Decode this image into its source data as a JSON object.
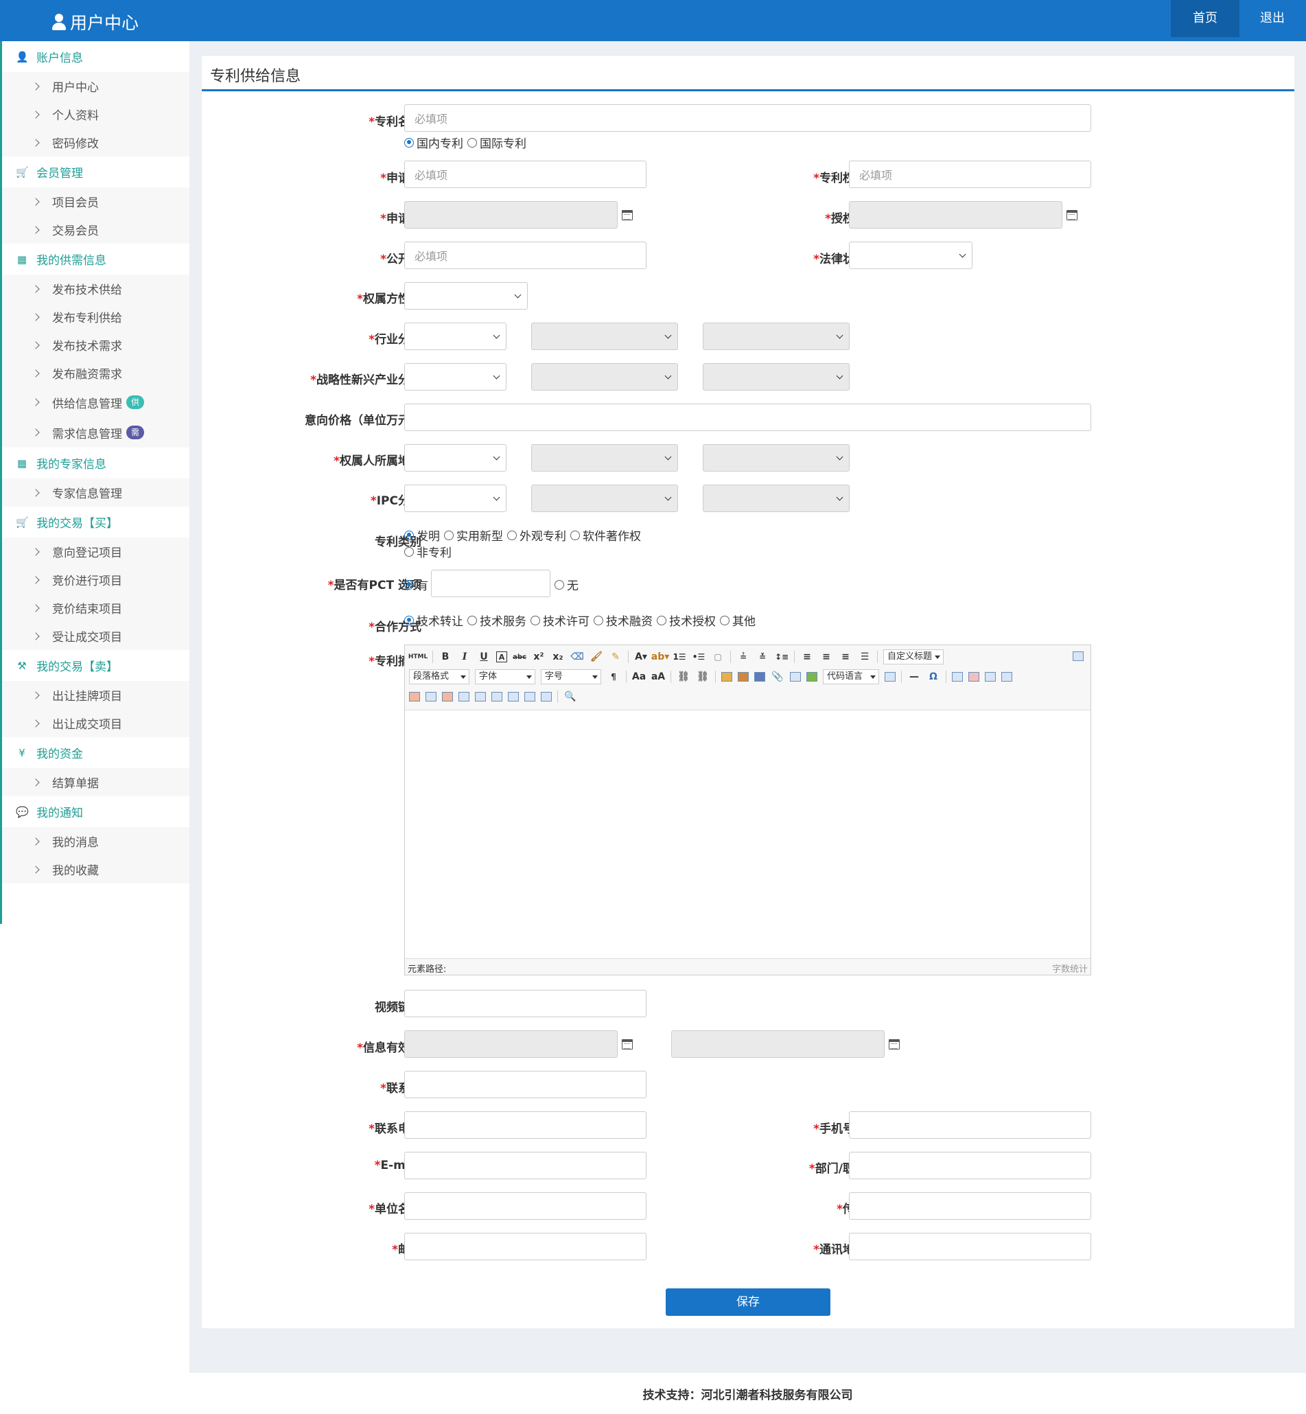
{
  "header": {
    "title": "用户中心",
    "nav": [
      "首页",
      "退出"
    ]
  },
  "sidebar": {
    "sections": [
      {
        "label": "账户信息",
        "icon": "user-icon",
        "items": [
          "用户中心",
          "个人资料",
          "密码修改"
        ]
      },
      {
        "label": "会员管理",
        "icon": "cart-icon",
        "items": [
          "项目会员",
          "交易会员"
        ]
      },
      {
        "label": "我的供需信息",
        "icon": "windows-icon",
        "items": [
          "发布技术供给",
          "发布专利供给",
          "发布技术需求",
          "发布融资需求",
          "供给信息管理",
          "需求信息管理"
        ]
      },
      {
        "label": "我的专家信息",
        "icon": "windows-icon",
        "items": [
          "专家信息管理"
        ]
      },
      {
        "label": "我的交易【买】",
        "icon": "cart-icon",
        "items": [
          "意向登记项目",
          "竞价进行项目",
          "竞价结束项目",
          "受让成交项目"
        ]
      },
      {
        "label": "我的交易【卖】",
        "icon": "gavel-icon",
        "items": [
          "出让挂牌项目",
          "出让成交项目"
        ]
      },
      {
        "label": "我的资金",
        "icon": "yen-icon",
        "items": [
          "结算单据"
        ]
      },
      {
        "label": "我的通知",
        "icon": "comments-icon",
        "items": [
          "我的消息",
          "我的收藏"
        ]
      }
    ],
    "badges": {
      "supply": "供",
      "demand": "需"
    }
  },
  "panel": {
    "title": "专利供给信息"
  },
  "form": {
    "required_mark": "*",
    "placeholder": "必填项",
    "labels": {
      "patent_name": "专利名称",
      "app_no": "申请号",
      "patentee": "专利权人",
      "app_date": "申请日",
      "grant_date": "授权日",
      "pub_no": "公开号",
      "legal_status": "法律状态",
      "owner_nature": "权属方性质",
      "industry": "行业分类",
      "strategic": "战略性新兴产业分类",
      "price": "意向价格（单位万元）",
      "region": "权属人所属地域",
      "ipc": "IPC分类",
      "patent_type": "专利类别",
      "pct": "是否有PCT 选项",
      "coop": "合作方式",
      "abstract": "专利摘要",
      "video": "视频链接",
      "validity": "信息有效期",
      "contact": "联系人",
      "phone": "联系电话",
      "mobile": "手机号码",
      "email": "E-mail",
      "dept": "部门/职务",
      "org": "单位名称",
      "fax": "传真",
      "zip": "邮编",
      "address": "通讯地址"
    },
    "scope_options": [
      "国内专利",
      "国际专利"
    ],
    "type_options": [
      "发明",
      "实用新型",
      "外观专利",
      "软件著作权",
      "非专利"
    ],
    "pct_yes": "有",
    "pct_no": "无",
    "coop_options": [
      "技术转让",
      "技术服务",
      "技术许可",
      "技术融资",
      "技术授权",
      "其他"
    ],
    "save_label": "保存"
  },
  "editor": {
    "html_label": "HTML",
    "custom_title": "自定义标题",
    "paragraph": "段落格式",
    "font": "字体",
    "size": "字号",
    "code_lang": "代码语言",
    "path_label": "元素路径:",
    "word_count": "字数统计"
  },
  "footer": {
    "text": "技术支持：河北引潮者科技服务有限公司"
  }
}
